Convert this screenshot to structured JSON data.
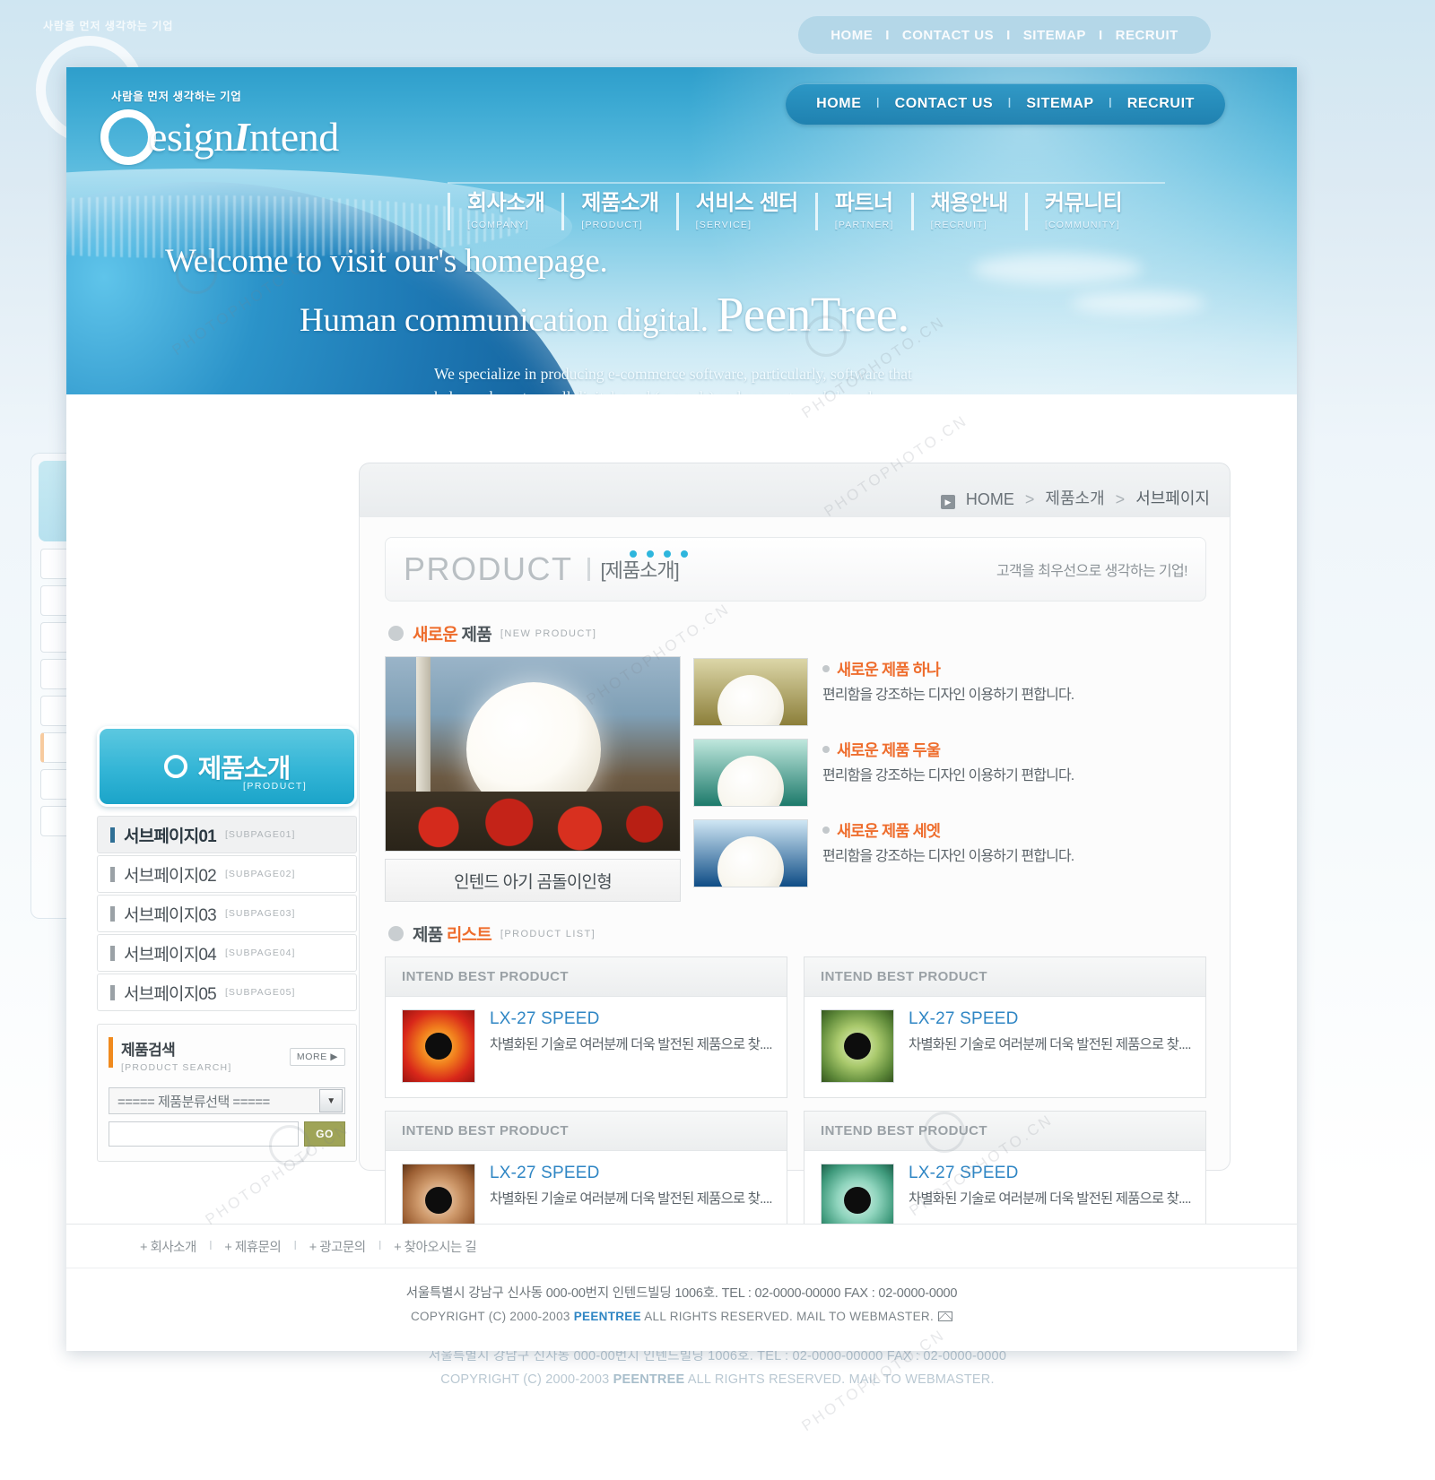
{
  "header": {
    "logo_tagline": "사람을 먼저 생각하는 기업",
    "logo_d": "D",
    "logo_text_1": "esign",
    "logo_text_i": "I",
    "logo_text_2": "ntend",
    "top_nav": [
      {
        "label": "HOME"
      },
      {
        "label": "CONTACT US"
      },
      {
        "label": "SITEMAP"
      },
      {
        "label": "RECRUIT"
      }
    ],
    "top_nav_separator": "I",
    "main_nav": [
      {
        "kr": "회사소개",
        "en": "[COMPANY]"
      },
      {
        "kr": "제품소개",
        "en": "[PRODUCT]"
      },
      {
        "kr": "서비스 센터",
        "en": "[SERVICE]"
      },
      {
        "kr": "파트너",
        "en": "[PARTNER]"
      },
      {
        "kr": "채용안내",
        "en": "[RECRUIT]"
      },
      {
        "kr": "커뮤니티",
        "en": "[COMMUNITY]"
      }
    ]
  },
  "hero": {
    "line1": "Welcome to visit our's homepage.",
    "line2_pre": "Human communication digital.",
    "line2_brand": "PeenTree.",
    "paragraph": "We specialize in producing e-commerce software, particularly, software that helps webmasters sell digital good (e-goods) and access to web-based content. Our list of available software includes scripts for secure password protection of web content, downloadable goods, and website membership management."
  },
  "breadcrumb": {
    "arrow": "▶",
    "home": "HOME",
    "sep": ">",
    "section": "제품소개",
    "current": "서브페이지"
  },
  "sidebar": {
    "head_kr": "제품소개",
    "head_en": "[PRODUCT]",
    "items": [
      {
        "kr": "서브페이지01",
        "en": "[SUBPAGE01]",
        "active": true
      },
      {
        "kr": "서브페이지02",
        "en": "[SUBPAGE02]",
        "active": false
      },
      {
        "kr": "서브페이지03",
        "en": "[SUBPAGE03]",
        "active": false
      },
      {
        "kr": "서브페이지04",
        "en": "[SUBPAGE04]",
        "active": false
      },
      {
        "kr": "서브페이지05",
        "en": "[SUBPAGE05]",
        "active": false
      }
    ],
    "search": {
      "title_kr": "제품검색",
      "title_en": "[PRODUCT SEARCH]",
      "more": "MORE ▶",
      "select_value": "===== 제품분류선택 =====",
      "select_arrow": "▼",
      "input_value": "",
      "input_placeholder": "",
      "go_label": "GO"
    }
  },
  "page_title": {
    "en": "PRODUCT",
    "kr": "[제품소개]",
    "slogan": "고객을 최우선으로 생각하는 기업!"
  },
  "new_product": {
    "heading_kr_1": "새로운",
    "heading_kr_2": "제품",
    "heading_en": "[NEW PRODUCT]",
    "feature_caption": "인텐드 아기 곰돌이인형",
    "items": [
      {
        "title": "새로운 제품 하나",
        "desc": "편리함을 강조하는 디자인 이용하기 편합니다."
      },
      {
        "title": "새로운 제품 두울",
        "desc": "편리함을 강조하는 디자인 이용하기 편합니다."
      },
      {
        "title": "새로운 제품 세엣",
        "desc": "편리함을 강조하는 디자인 이용하기 편합니다."
      }
    ]
  },
  "product_list": {
    "heading_kr_1": "제품",
    "heading_kr_2": "리스트",
    "heading_en": "[PRODUCT LIST]",
    "cards": [
      {
        "header": "INTEND BEST PRODUCT",
        "name": "LX-27 SPEED",
        "desc": "차별화된 기술로 여러분께 더욱 발전된 제품으로 찾...."
      },
      {
        "header": "INTEND BEST PRODUCT",
        "name": "LX-27 SPEED",
        "desc": "차별화된 기술로 여러분께 더욱 발전된 제품으로 찾...."
      },
      {
        "header": "INTEND BEST PRODUCT",
        "name": "LX-27 SPEED",
        "desc": "차별화된 기술로 여러분께 더욱 발전된 제품으로 찾...."
      },
      {
        "header": "INTEND BEST PRODUCT",
        "name": "LX-27 SPEED",
        "desc": "차별화된 기술로 여러분께 더욱 발전된 제품으로 찾...."
      }
    ]
  },
  "footer": {
    "links": [
      {
        "label": "+ 회사소개"
      },
      {
        "label": "+ 제휴문의"
      },
      {
        "label": "+ 광고문의"
      },
      {
        "label": "+ 찾아오시는 길"
      }
    ],
    "link_sep": "I",
    "address": "서울특별시  강남구 신사동 000-00번지 인텐드빌딩 1006호.  TEL : 02-0000-00000  FAX : 02-0000-0000",
    "copyright_pre": "COPYRIGHT (C) 2000-2003 ",
    "copyright_brand": "PEENTREE",
    "copyright_post": "  ALL RIGHTS RESERVED. MAIL TO WEBMASTER."
  },
  "colors": {
    "brand_cyan": "#2eb6dd",
    "header_blue": "#2e9ecb",
    "accent_orange": "#ee6d2d",
    "link_blue": "#2f86c4",
    "go_olive": "#9fa457"
  },
  "watermarks": {
    "site": "PHOTOPHOTO.CN"
  }
}
